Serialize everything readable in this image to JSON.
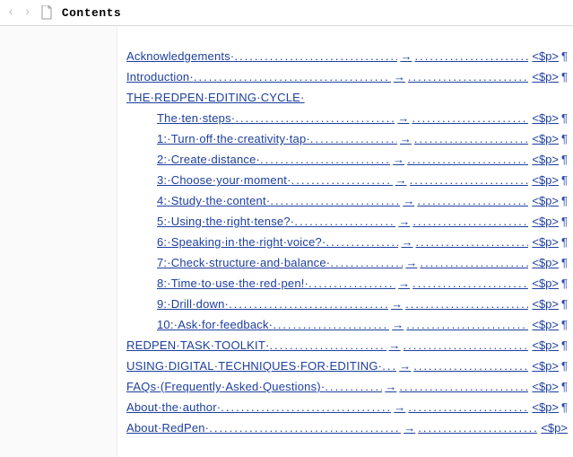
{
  "header": {
    "back_glyph": "‹",
    "forward_glyph": "›",
    "title": "Contents"
  },
  "marks": {
    "tab": "→",
    "para_open": "<$p>",
    "pilcrow": "¶",
    "mid_dot": "·"
  },
  "toc": [
    {
      "indent": 0,
      "text": "Acknowledgements·",
      "leader_w": 182,
      "gap_w": 130
    },
    {
      "indent": 0,
      "text": "Introduction·",
      "leader_w": 220,
      "gap_w": 130
    },
    {
      "indent": 0,
      "text": "THE·REDPEN·EDITING·CYCLE·",
      "leader_w": 0,
      "gap_w": 0,
      "no_trail": true
    },
    {
      "indent": 1,
      "text": "The·ten·steps·",
      "leader_w": 178,
      "gap_w": 130
    },
    {
      "indent": 2,
      "text": "1:·Turn·off·the·creativity·tap·",
      "leader_w": 97,
      "gap_w": 128
    },
    {
      "indent": 2,
      "text": "2:·Create·distance·",
      "leader_w": 145,
      "gap_w": 130
    },
    {
      "indent": 2,
      "text": "3:·Choose·your·moment·",
      "leader_w": 113,
      "gap_w": 130
    },
    {
      "indent": 2,
      "text": "4:·Study·the·content·",
      "leader_w": 145,
      "gap_w": 128
    },
    {
      "indent": 2,
      "text": "5:·Using·the·right·tense?·",
      "leader_w": 113,
      "gap_w": 128
    },
    {
      "indent": 2,
      "text": "6:·Speaking·in·the·right·voice?·",
      "leader_w": 81,
      "gap_w": 120
    },
    {
      "indent": 2,
      "text": "7:·Check·structure·and·balance·",
      "leader_w": 81,
      "gap_w": 120
    },
    {
      "indent": 2,
      "text": "8:·Time·to·use·the·red·pen!·",
      "leader_w": 97,
      "gap_w": 128
    },
    {
      "indent": 2,
      "text": "9:·Drill·down·",
      "leader_w": 178,
      "gap_w": 130
    },
    {
      "indent": 2,
      "text": "10:·Ask·for·feedback·",
      "leader_w": 130,
      "gap_w": 130
    },
    {
      "indent": 0,
      "text": "REDPEN·TASK·TOOLKIT·",
      "leader_w": 130,
      "gap_w": 130
    },
    {
      "indent": 0,
      "text": "USING·DIGITAL·TECHNIQUES·FOR·EDITING·",
      "leader_w": 16,
      "gap_w": 112
    },
    {
      "indent": 0,
      "text": "FAQs·(Frequently·Asked·Questions)·",
      "leader_w": 64,
      "gap_w": 112
    },
    {
      "indent": 0,
      "text": "About·the·author·",
      "leader_w": 190,
      "gap_w": 130
    },
    {
      "indent": 0,
      "text": "About·RedPen·",
      "leader_w": 214,
      "gap_w": 130,
      "last": true
    }
  ]
}
